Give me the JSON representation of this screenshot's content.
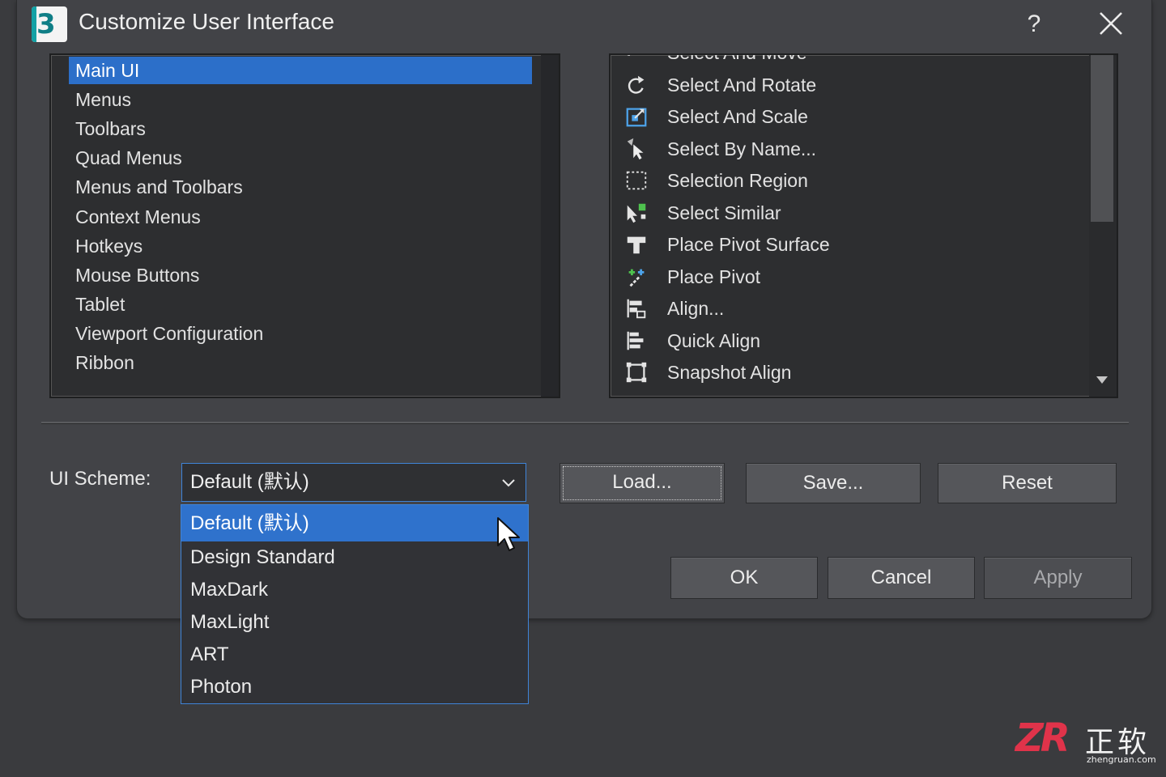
{
  "window": {
    "title": "Customize User Interface",
    "help_label": "?",
    "logo_text": "3"
  },
  "categories": {
    "items": [
      {
        "label": "Main UI",
        "selected": true
      },
      {
        "label": "Menus"
      },
      {
        "label": "Toolbars"
      },
      {
        "label": "Quad Menus"
      },
      {
        "label": "Menus and Toolbars"
      },
      {
        "label": "Context Menus"
      },
      {
        "label": "Hotkeys"
      },
      {
        "label": "Mouse Buttons"
      },
      {
        "label": "Tablet"
      },
      {
        "label": "Viewport Configuration"
      },
      {
        "label": "Ribbon"
      }
    ]
  },
  "commands": {
    "items": [
      {
        "label": "Select And Move",
        "icon": "move-icon"
      },
      {
        "label": "Select And Rotate",
        "icon": "rotate-icon"
      },
      {
        "label": "Select And Scale",
        "icon": "scale-icon"
      },
      {
        "label": "Select By Name...",
        "icon": "select-by-name-icon"
      },
      {
        "label": "Selection Region",
        "icon": "selection-region-icon"
      },
      {
        "label": "Select Similar",
        "icon": "select-similar-icon"
      },
      {
        "label": "Place Pivot Surface",
        "icon": "place-pivot-surface-icon"
      },
      {
        "label": "Place Pivot",
        "icon": "place-pivot-icon"
      },
      {
        "label": "Align...",
        "icon": "align-icon"
      },
      {
        "label": "Quick Align",
        "icon": "quick-align-icon"
      },
      {
        "label": "Snapshot Align",
        "icon": "snapshot-align-icon"
      }
    ]
  },
  "scheme": {
    "label": "UI Scheme:",
    "value": "Default (默认)",
    "options": [
      {
        "label": "Default (默认)",
        "selected": true
      },
      {
        "label": "Design Standard"
      },
      {
        "label": "MaxDark"
      },
      {
        "label": "MaxLight"
      },
      {
        "label": "ART"
      },
      {
        "label": "Photon"
      }
    ]
  },
  "buttons": {
    "load": "Load...",
    "save": "Save...",
    "reset": "Reset",
    "ok": "OK",
    "cancel": "Cancel",
    "apply": "Apply"
  },
  "watermark": {
    "logo": "ZR",
    "text": "正软",
    "url": "zhengruan.com"
  },
  "colors": {
    "accent": "#2c6fc9",
    "dialog_bg": "#424347",
    "list_bg": "#2d2e30",
    "watermark_red": "#e0334a"
  }
}
